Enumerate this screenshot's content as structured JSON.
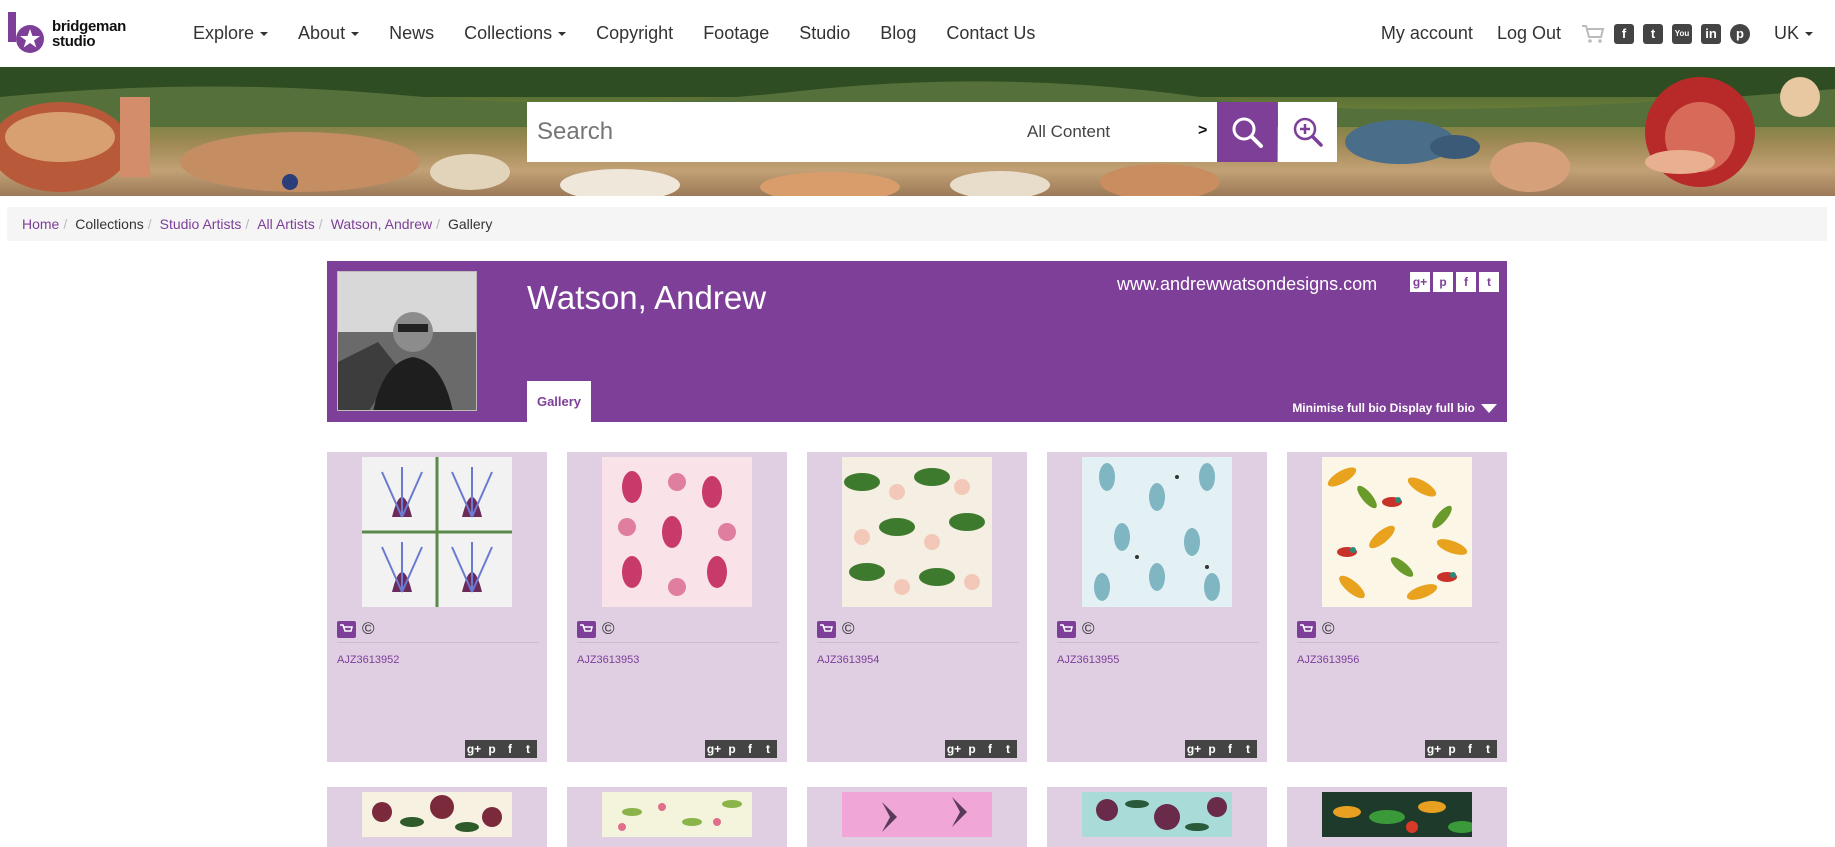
{
  "logo": {
    "line1": "bridgeman",
    "line2": "studio"
  },
  "nav": {
    "items": [
      {
        "label": "Explore",
        "dropdown": true
      },
      {
        "label": "About",
        "dropdown": true
      },
      {
        "label": "News",
        "dropdown": false
      },
      {
        "label": "Collections",
        "dropdown": true
      },
      {
        "label": "Copyright",
        "dropdown": false
      },
      {
        "label": "Footage",
        "dropdown": false
      },
      {
        "label": "Studio",
        "dropdown": false
      },
      {
        "label": "Blog",
        "dropdown": false
      },
      {
        "label": "Contact Us",
        "dropdown": false
      }
    ],
    "account": "My account",
    "logout": "Log Out",
    "social": [
      "facebook-icon",
      "twitter-icon",
      "youtube-icon",
      "linkedin-icon",
      "pinterest-icon"
    ],
    "region": "UK"
  },
  "search": {
    "placeholder": "Search",
    "scope": "All Content",
    "scope_arrow": ">"
  },
  "breadcrumb": [
    {
      "label": "Home",
      "link": true
    },
    {
      "label": "Collections",
      "link": false
    },
    {
      "label": "Studio Artists",
      "link": true
    },
    {
      "label": "All Artists",
      "link": true
    },
    {
      "label": "Watson, Andrew",
      "link": true
    },
    {
      "label": "Gallery",
      "link": false
    }
  ],
  "artist": {
    "name": "Watson, Andrew",
    "website": "www.andrewwatsondesigns.com",
    "tab": "Gallery",
    "bio_toggle": "Minimise full bio Display full bio"
  },
  "gallery": {
    "items": [
      {
        "ref": "AJZ3613952",
        "pattern": "thistle"
      },
      {
        "ref": "AJZ3613953",
        "pattern": "bees"
      },
      {
        "ref": "AJZ3613954",
        "pattern": "blossom"
      },
      {
        "ref": "AJZ3613955",
        "pattern": "teal-leaves"
      },
      {
        "ref": "AJZ3613956",
        "pattern": "birds"
      }
    ],
    "row2": [
      "peony",
      "meadow",
      "pink-butterfly",
      "teal-peony",
      "tropical"
    ]
  },
  "colors": {
    "brand_purple": "#7d3f98",
    "card_bg": "#e0cfe3",
    "breadcrumb_bg": "#f5f5f5"
  }
}
